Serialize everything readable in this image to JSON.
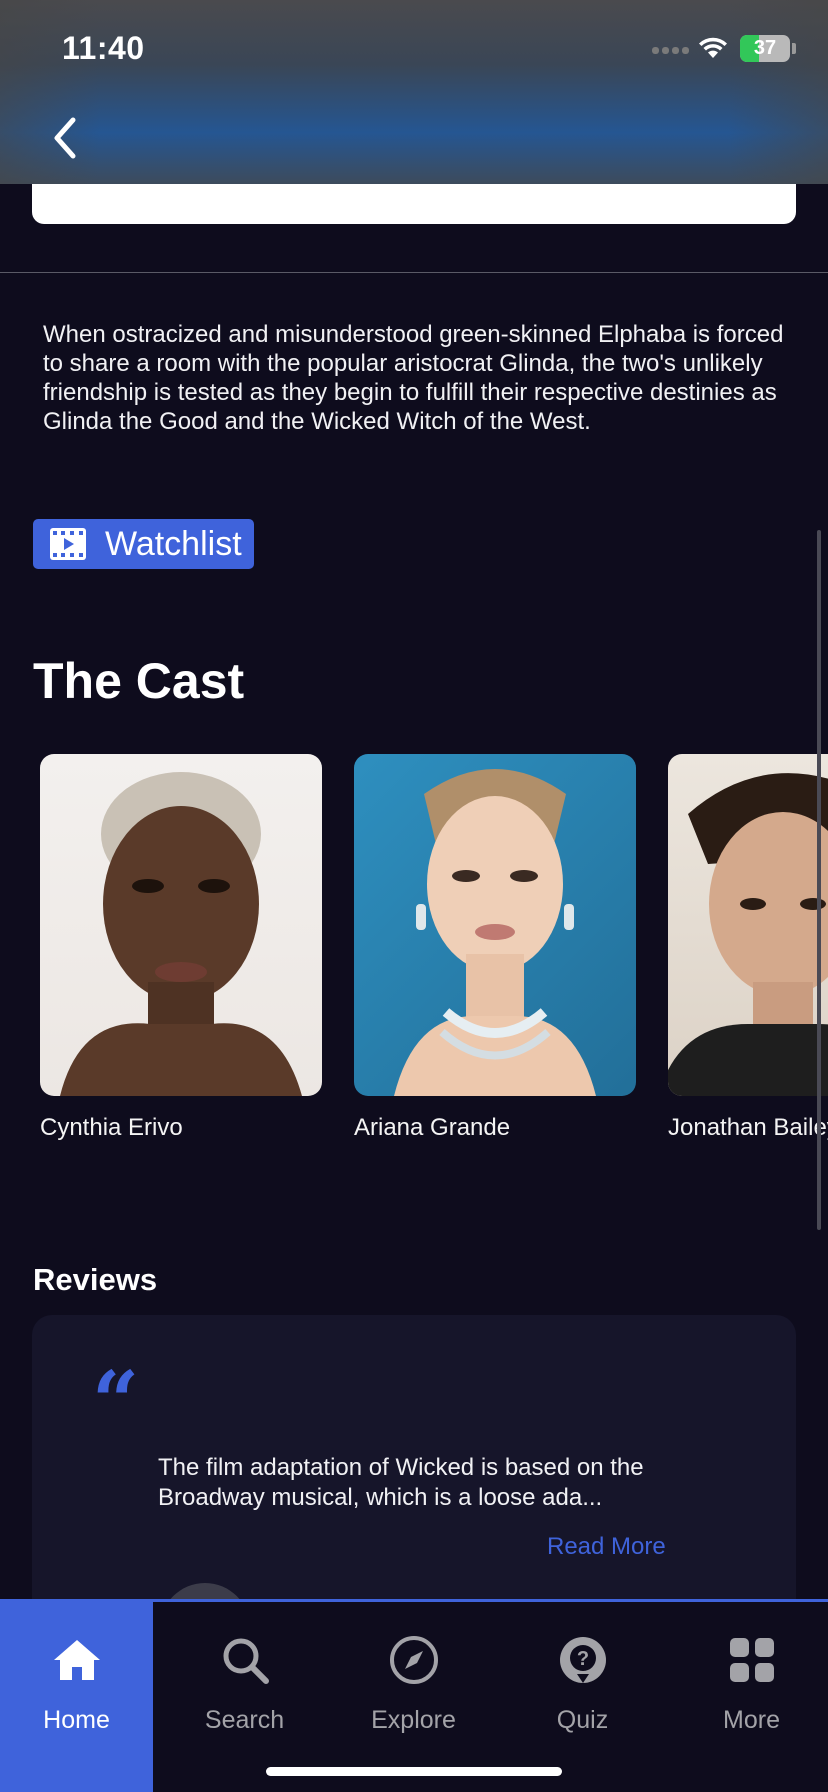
{
  "status_bar": {
    "time": "11:40",
    "battery": "37",
    "battery_level": 0.37
  },
  "overview": "When ostracized and misunderstood green-skinned Elphaba is forced to share a room with the popular aristocrat Glinda, the two's unlikely friendship is tested as they begin to fulfill their respective destinies as Glinda the Good and the Wicked Witch of the West.",
  "watchlist": {
    "label": "Watchlist",
    "icon": "film-icon"
  },
  "cast": {
    "title": "The Cast",
    "members": [
      {
        "name": "Cynthia Erivo"
      },
      {
        "name": "Ariana Grande"
      },
      {
        "name": "Jonathan Bailey"
      }
    ]
  },
  "reviews": {
    "title": "Reviews",
    "quote_mark": "“",
    "text": "The film adaptation of Wicked is based on the Broadway musical, which is a loose ada...",
    "read_more": "Read More"
  },
  "tabs": [
    {
      "label": "Home",
      "icon": "home-icon",
      "active": true
    },
    {
      "label": "Search",
      "icon": "search-icon",
      "active": false
    },
    {
      "label": "Explore",
      "icon": "compass-icon",
      "active": false
    },
    {
      "label": "Quiz",
      "icon": "quiz-icon",
      "active": false
    },
    {
      "label": "More",
      "icon": "grid-icon",
      "active": false
    }
  ],
  "colors": {
    "accent": "#3f63db",
    "background": "#0e0c1d",
    "card": "#16152a"
  }
}
